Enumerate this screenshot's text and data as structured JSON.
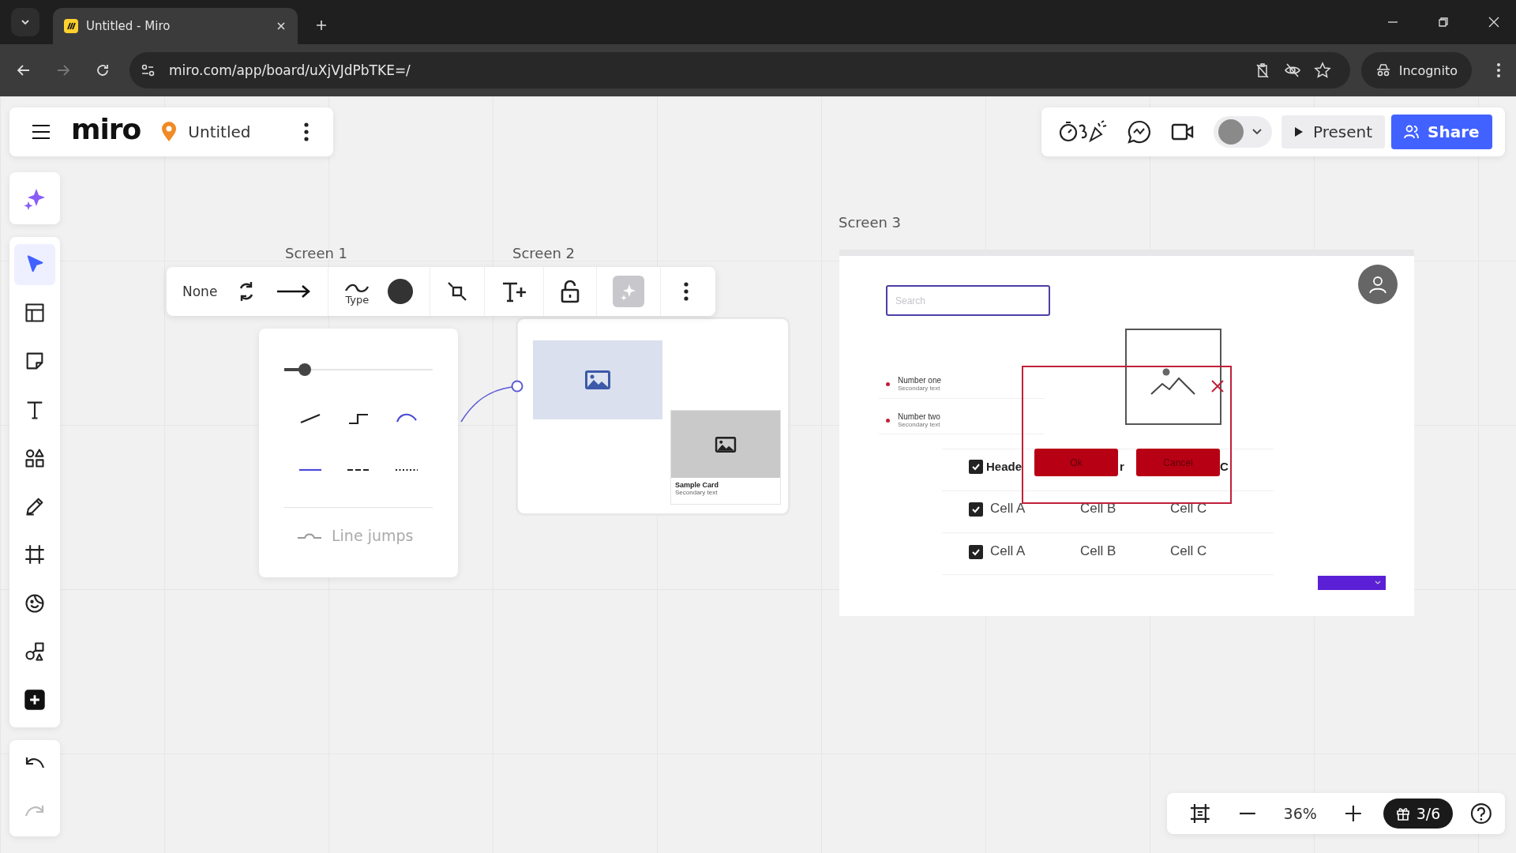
{
  "browser": {
    "tab_title": "Untitled - Miro",
    "url": "miro.com/app/board/uXjVJdPbTKE=/",
    "profile": "Incognito",
    "forward_disabled": true
  },
  "board_header": {
    "logo": "miro",
    "title": "Untitled"
  },
  "top_actions": {
    "present": "Present",
    "share": "Share"
  },
  "tools": [
    {
      "kind": "select",
      "selected": true
    },
    {
      "kind": "templates",
      "selected": false
    },
    {
      "kind": "sticky",
      "selected": false
    },
    {
      "kind": "text",
      "selected": false
    },
    {
      "kind": "shapes",
      "selected": false
    },
    {
      "kind": "pen",
      "selected": false
    },
    {
      "kind": "frame",
      "selected": false
    },
    {
      "kind": "stickers",
      "selected": false
    },
    {
      "kind": "diagram",
      "selected": false
    },
    {
      "kind": "add",
      "selected": false
    }
  ],
  "history": {
    "undo_disabled": false,
    "redo_disabled": true
  },
  "frame_labels": [
    "Screen 1",
    "Screen 2",
    "Screen 3"
  ],
  "context_toolbar": {
    "start_cap": "None",
    "type_label": "Type",
    "ai_disabled": true
  },
  "line_panel": {
    "thickness": {
      "level": 0.14
    },
    "types": [
      {
        "kind": "straight",
        "selected": false
      },
      {
        "kind": "elbow",
        "selected": false
      },
      {
        "kind": "curved",
        "selected": true
      }
    ],
    "styles": [
      {
        "kind": "solid",
        "selected": true
      },
      {
        "kind": "dashed",
        "selected": false
      },
      {
        "kind": "dotted",
        "selected": false
      }
    ],
    "line_jumps": {
      "label": "Line jumps",
      "disabled": true
    }
  },
  "screen2": {
    "card_title": "Sample Card",
    "card_subtitle": "Secondary text"
  },
  "screen3": {
    "search_placeholder": "Search",
    "list": [
      {
        "title": "Number one",
        "subtitle": "Secondary text"
      },
      {
        "title": "Number two",
        "subtitle": "Secondary text"
      }
    ],
    "table": {
      "header": {
        "checked": true,
        "cells": [
          "Heade",
          "r",
          "C"
        ]
      },
      "rows": [
        {
          "checked": true,
          "cells": [
            "Cell A",
            "Cell B",
            "Cell C"
          ]
        },
        {
          "checked": true,
          "cells": [
            "Cell A",
            "Cell B",
            "Cell C"
          ]
        }
      ]
    },
    "dialog": {
      "ok": "Ok",
      "cancel": "Cancel"
    }
  },
  "zoom": {
    "level_text": "36%",
    "tour_progress": "3/6"
  }
}
